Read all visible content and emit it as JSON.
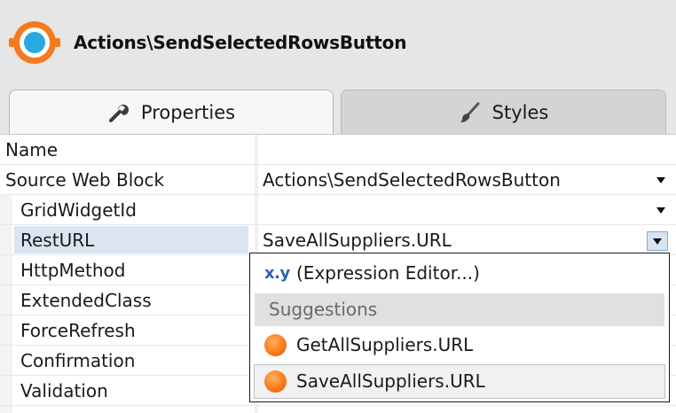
{
  "header": {
    "title": "Actions\\SendSelectedRowsButton",
    "icon": "web-block-icon",
    "icon_color": "#f47a20",
    "icon_inner_color": "#2aa8e0"
  },
  "tabs": [
    {
      "label": "Properties",
      "icon": "wrench-icon",
      "active": true
    },
    {
      "label": "Styles",
      "icon": "brush-icon",
      "active": false
    }
  ],
  "properties": [
    {
      "name": "Name",
      "value": "",
      "indent": 0,
      "dropdown": false
    },
    {
      "name": "Source Web Block",
      "value": "Actions\\SendSelectedRowsButton",
      "indent": 0,
      "dropdown": true
    },
    {
      "name": "GridWidgetId",
      "value": "",
      "indent": 1,
      "dropdown": true
    },
    {
      "name": "RestURL",
      "value": "SaveAllSuppliers.URL",
      "indent": 1,
      "dropdown": true,
      "selected": true
    },
    {
      "name": "HttpMethod",
      "value": "",
      "indent": 1,
      "dropdown": false
    },
    {
      "name": "ExtendedClass",
      "value": "",
      "indent": 1,
      "dropdown": false
    },
    {
      "name": "ForceRefresh",
      "value": "",
      "indent": 1,
      "dropdown": false
    },
    {
      "name": "Confirmation",
      "value": "",
      "indent": 1,
      "dropdown": false
    },
    {
      "name": "Validation",
      "value": "",
      "indent": 1,
      "dropdown": false
    }
  ],
  "dropdown_popup": {
    "expression_icon": "x.y",
    "expression_editor": "(Expression Editor...)",
    "section_label": "Suggestions",
    "suggestions": [
      {
        "label": "GetAllSuppliers.URL",
        "icon": "orange-dot-icon",
        "selected": false
      },
      {
        "label": "SaveAllSuppliers.URL",
        "icon": "orange-dot-icon",
        "selected": true
      }
    ]
  },
  "colors": {
    "accent_orange": "#f47a20",
    "selection_blue": "#dbe4f0",
    "expression_blue": "#2e63b0"
  }
}
